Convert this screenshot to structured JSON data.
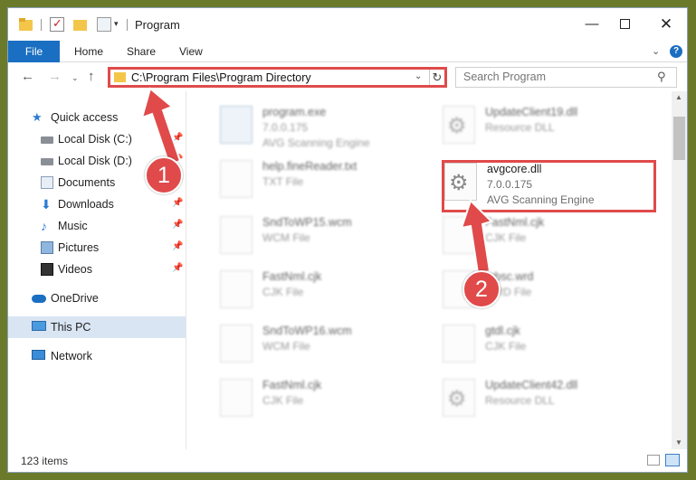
{
  "window": {
    "title": "Program",
    "controls": {
      "minimize": "—",
      "maximize": "",
      "close": "✕"
    }
  },
  "ribbon": {
    "tabs": [
      "File",
      "Home",
      "Share",
      "View"
    ],
    "help": "?"
  },
  "address": {
    "path": "C:\\Program Files\\Program Directory"
  },
  "search": {
    "placeholder": "Search Program"
  },
  "sidebar": {
    "items": [
      {
        "label": "Quick access",
        "icon": "star-icon",
        "pinned": false
      },
      {
        "label": "Local Disk (C:)",
        "icon": "drive-icon",
        "pinned": true
      },
      {
        "label": "Local Disk (D:)",
        "icon": "drive-icon",
        "pinned": true
      },
      {
        "label": "Documents",
        "icon": "documents-icon",
        "pinned": true
      },
      {
        "label": "Downloads",
        "icon": "downloads-icon",
        "pinned": true
      },
      {
        "label": "Music",
        "icon": "music-icon",
        "pinned": true
      },
      {
        "label": "Pictures",
        "icon": "pictures-icon",
        "pinned": true
      },
      {
        "label": "Videos",
        "icon": "videos-icon",
        "pinned": true
      },
      {
        "label": "OneDrive",
        "icon": "cloud-icon",
        "pinned": false
      },
      {
        "label": "This PC",
        "icon": "computer-icon",
        "pinned": false,
        "selected": true
      },
      {
        "label": "Network",
        "icon": "network-icon",
        "pinned": false
      }
    ]
  },
  "files": [
    {
      "name": "program.exe",
      "line1": "7.0.0.175",
      "line2": "AVG Scanning Engine",
      "icon": "exe-icon"
    },
    {
      "name": "UpdateClient19.dll",
      "line1": "Resource DLL",
      "line2": "",
      "icon": "dll-icon"
    },
    {
      "name": "help.fineReader.txt",
      "line1": "TXT File",
      "line2": "",
      "icon": "file-icon"
    },
    {
      "name": "avgcore.dll",
      "line1": "7.0.0.175",
      "line2": "AVG Scanning Engine",
      "icon": "dll-icon",
      "highlighted": true
    },
    {
      "name": "SndToWP15.wcm",
      "line1": "WCM File",
      "line2": "",
      "icon": "file-icon"
    },
    {
      "name": "FastNml.cjk",
      "line1": "CJK File",
      "line2": "",
      "icon": "file-icon"
    },
    {
      "name": "FastNml.cjk",
      "line1": "CJK File",
      "line2": "",
      "icon": "file-icon"
    },
    {
      "name": "mbsc.wrd",
      "line1": "WRD File",
      "line2": "",
      "icon": "file-icon"
    },
    {
      "name": "SndToWP16.wcm",
      "line1": "WCM File",
      "line2": "",
      "icon": "file-icon"
    },
    {
      "name": "gtdl.cjk",
      "line1": "CJK File",
      "line2": "",
      "icon": "file-icon"
    },
    {
      "name": "FastNml.cjk",
      "line1": "CJK File",
      "line2": "",
      "icon": "file-icon"
    },
    {
      "name": "UpdateClient42.dll",
      "line1": "Resource DLL",
      "line2": "",
      "icon": "dll-icon"
    }
  ],
  "status": {
    "item_count": "123 items"
  },
  "annotations": {
    "badge1": "1",
    "badge2": "2"
  },
  "colors": {
    "accent": "#1a6fc2",
    "annotation_red": "#e04a4a",
    "selection": "#d9e5f3"
  }
}
